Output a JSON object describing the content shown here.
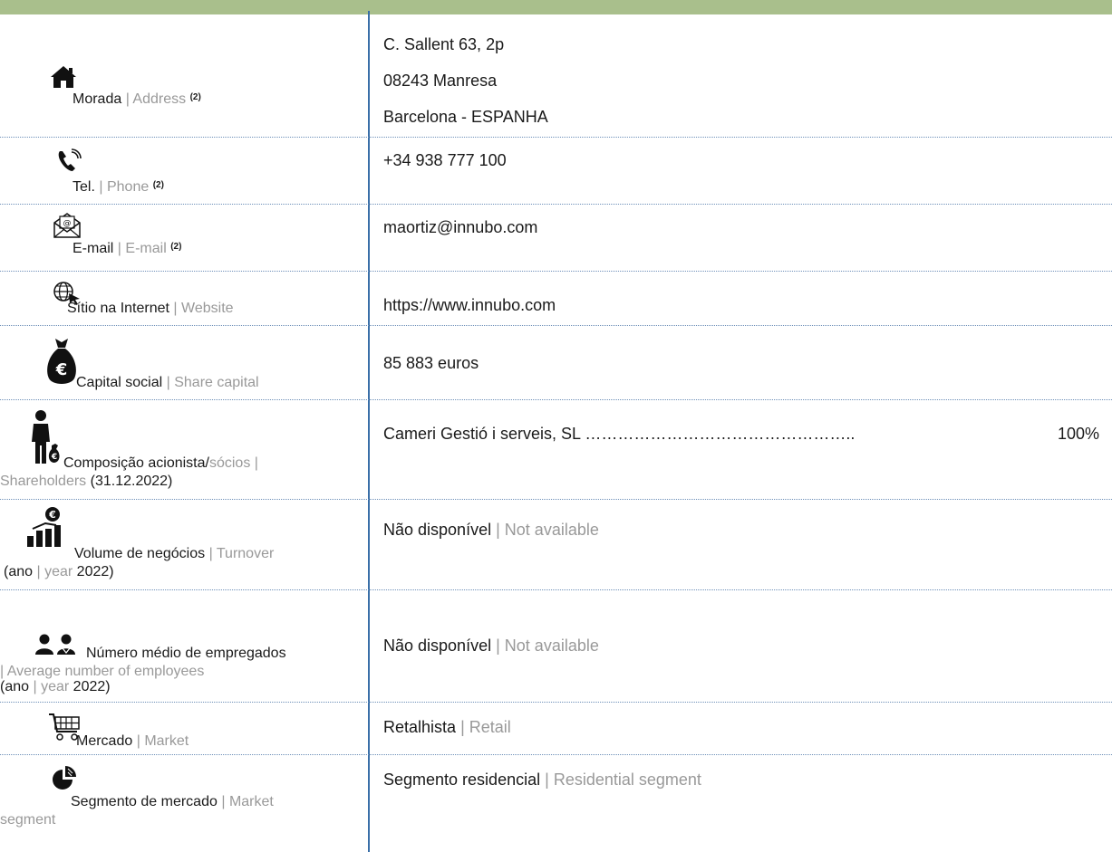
{
  "rows": {
    "address": {
      "icon": "home-icon",
      "label_pt": "Morada",
      "label_en": "Address",
      "note": "(2)",
      "lines": [
        "C. Sallent 63, 2p",
        "08243 Manresa",
        "Barcelona - ESPANHA"
      ]
    },
    "phone": {
      "icon": "phone-icon",
      "label_pt": "Tel.",
      "label_en": "Phone",
      "note": "(2)",
      "value": "+34 938 777 100"
    },
    "email": {
      "icon": "email-icon",
      "label_pt": "E-mail",
      "label_en": "E-mail",
      "note": "(2)",
      "value": "maortiz@innubo.com"
    },
    "website": {
      "icon": "globe-cursor-icon",
      "label_pt": "Sítio na Internet",
      "label_en": "Website",
      "value": "https://www.innubo.com"
    },
    "capital": {
      "icon": "money-bag-euro-icon",
      "label_pt": "Capital social",
      "label_en": "Share capital",
      "value": "85 883 euros"
    },
    "shareholders": {
      "icon": "person-money-bag-icon",
      "label_pt": "Composição acionista/",
      "label_pt2": "sócios",
      "label_en": "Shareholders",
      "date": "(31.12.2022)",
      "holder": "Cameri Gestió i serveis, SL",
      "dots": "…………………………………………..",
      "share": "100%"
    },
    "turnover": {
      "icon": "euro-bar-chart-icon",
      "label_pt": "Volume de negócios",
      "label_en": "Turnover",
      "year_pt": "(ano",
      "year_en": "year",
      "year": "2022)",
      "value_pt": "Não disponível",
      "value_en": "Not available"
    },
    "employees": {
      "icon": "people-icon",
      "label_pt": "Número médio de empregados",
      "label_en": "| Average number of employees",
      "year_pt": "(ano",
      "year_en": "year",
      "year": "2022)",
      "value_pt": "Não disponível",
      "value_en": "Not available"
    },
    "market": {
      "icon": "shopping-cart-icon",
      "label_pt": "Mercado",
      "label_en": "Market",
      "value_pt": "Retalhista",
      "value_en": "Retail"
    },
    "segment": {
      "icon": "pie-chart-icon",
      "label_pt": "Segmento de mercado",
      "label_en": "Market",
      "label_en2": "segment",
      "value_pt": "Segmento residencial",
      "value_en": "Residential segment"
    }
  },
  "separator": "|",
  "colors": {
    "top_bar": "#a9bf8c",
    "divider": "#3a6fa8",
    "english_text": "#999999"
  }
}
